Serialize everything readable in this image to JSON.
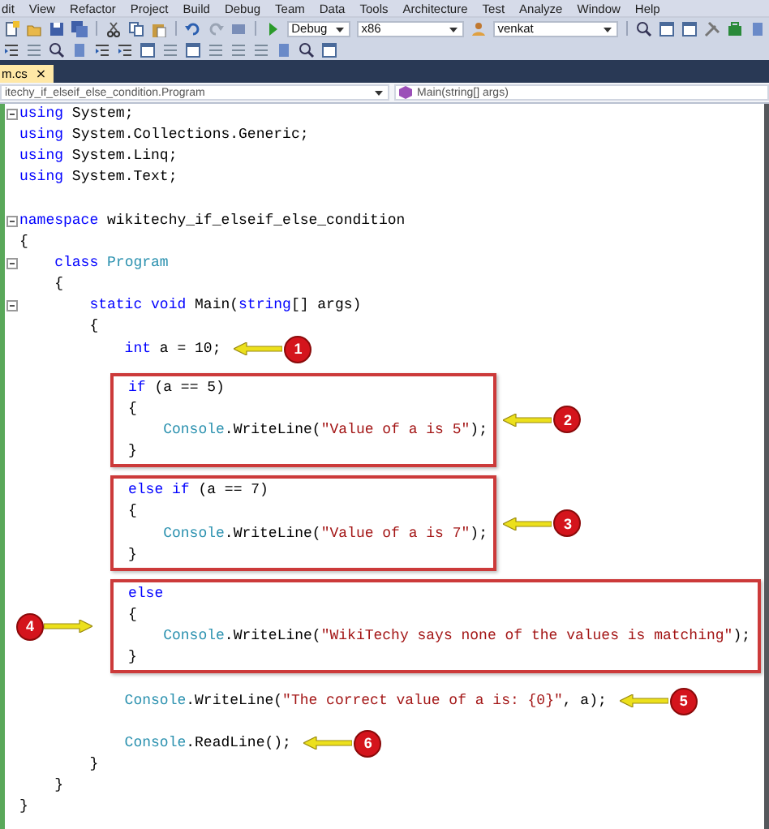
{
  "menu_bar": {
    "items": [
      "dit",
      "View",
      "Refactor",
      "Project",
      "Build",
      "Debug",
      "Team",
      "Data",
      "Tools",
      "Architecture",
      "Test",
      "Analyze",
      "Window",
      "Help"
    ]
  },
  "toolbar": {
    "configuration": "Debug",
    "platform": "x86",
    "user": "venkat"
  },
  "tabs": [
    {
      "label": "m.cs",
      "close_glyph": "×",
      "selected": true
    }
  ],
  "navigation_bar": {
    "type_scope": "itechy_if_elseif_else_condition.Program",
    "member": "Main(string[] args)"
  },
  "code": [
    {
      "kind": "line",
      "gap_before": false,
      "collapsible": true,
      "tokens": [
        {
          "kind": "keyword",
          "text": "using"
        },
        {
          "kind": "plain",
          "text": " System;"
        }
      ]
    },
    {
      "kind": "line",
      "gap_before": false,
      "collapsible": false,
      "tokens": [
        {
          "kind": "keyword",
          "text": "using"
        },
        {
          "kind": "plain",
          "text": " System.Collections.Generic;"
        }
      ]
    },
    {
      "kind": "line",
      "gap_before": false,
      "collapsible": false,
      "tokens": [
        {
          "kind": "keyword",
          "text": "using"
        },
        {
          "kind": "plain",
          "text": " System.Linq;"
        }
      ]
    },
    {
      "kind": "line",
      "gap_before": false,
      "collapsible": false,
      "tokens": [
        {
          "kind": "keyword",
          "text": "using"
        },
        {
          "kind": "plain",
          "text": " System.Text;"
        }
      ]
    },
    {
      "kind": "line",
      "gap_before": true,
      "collapsible": true,
      "tokens": [
        {
          "kind": "keyword",
          "text": "namespace"
        },
        {
          "kind": "plain",
          "text": " wikitechy_if_elseif_else_condition"
        }
      ]
    },
    {
      "kind": "line",
      "gap_before": false,
      "collapsible": false,
      "tokens": [
        {
          "kind": "plain",
          "text": "{"
        }
      ]
    },
    {
      "kind": "line",
      "gap_before": false,
      "collapsible": true,
      "tokens": [
        {
          "kind": "keyword",
          "text": "    class "
        },
        {
          "kind": "type",
          "text": "Program"
        }
      ]
    },
    {
      "kind": "line",
      "gap_before": false,
      "collapsible": false,
      "tokens": [
        {
          "kind": "plain",
          "text": "    {"
        }
      ]
    },
    {
      "kind": "line",
      "gap_before": false,
      "collapsible": true,
      "tokens": [
        {
          "kind": "keyword",
          "text": "        static void"
        },
        {
          "kind": "plain",
          "text": " Main("
        },
        {
          "kind": "keyword",
          "text": "string"
        },
        {
          "kind": "plain",
          "text": "[] args)"
        }
      ]
    },
    {
      "kind": "line",
      "gap_before": false,
      "collapsible": false,
      "tokens": [
        {
          "kind": "plain",
          "text": "        {"
        }
      ]
    },
    {
      "kind": "line",
      "gap_before": false,
      "collapsible": false,
      "callout": {
        "number": "1",
        "kind": "right"
      },
      "tokens": [
        {
          "kind": "keyword",
          "text": "            int"
        },
        {
          "kind": "plain",
          "text": " a = 10;"
        }
      ]
    },
    {
      "kind": "boxed",
      "gap_before": true,
      "callout": {
        "number": "2",
        "kind": "right"
      },
      "lines": [
        {
          "tokens": [
            {
              "kind": "keyword",
              "text": "if"
            },
            {
              "kind": "plain",
              "text": " (a == 5)"
            }
          ]
        },
        {
          "tokens": [
            {
              "kind": "plain",
              "text": "{"
            }
          ]
        },
        {
          "tokens": [
            {
              "kind": "type",
              "text": "    Console"
            },
            {
              "kind": "plain",
              "text": ".WriteLine("
            },
            {
              "kind": "string",
              "text": "\"Value of a is 5\""
            },
            {
              "kind": "plain",
              "text": ");"
            }
          ]
        },
        {
          "tokens": [
            {
              "kind": "plain",
              "text": "}"
            }
          ]
        }
      ]
    },
    {
      "kind": "boxed",
      "gap_before": true,
      "callout": {
        "number": "3",
        "kind": "right"
      },
      "lines": [
        {
          "tokens": [
            {
              "kind": "keyword",
              "text": "else if"
            },
            {
              "kind": "plain",
              "text": " (a == 7)"
            }
          ]
        },
        {
          "tokens": [
            {
              "kind": "plain",
              "text": "{"
            }
          ]
        },
        {
          "tokens": [
            {
              "kind": "type",
              "text": "    Console"
            },
            {
              "kind": "plain",
              "text": ".WriteLine("
            },
            {
              "kind": "string",
              "text": "\"Value of a is 7\""
            },
            {
              "kind": "plain",
              "text": ");"
            }
          ]
        },
        {
          "tokens": [
            {
              "kind": "plain",
              "text": "}"
            }
          ]
        }
      ]
    },
    {
      "kind": "boxed",
      "gap_before": true,
      "callout": {
        "number": "4",
        "kind": "left"
      },
      "lines": [
        {
          "tokens": [
            {
              "kind": "keyword",
              "text": "else"
            }
          ]
        },
        {
          "tokens": [
            {
              "kind": "plain",
              "text": "{"
            }
          ]
        },
        {
          "tokens": [
            {
              "kind": "type",
              "text": "    Console"
            },
            {
              "kind": "plain",
              "text": ".WriteLine("
            },
            {
              "kind": "string",
              "text": "\"WikiTechy says none of the values is matching\""
            },
            {
              "kind": "plain",
              "text": ");"
            }
          ]
        },
        {
          "tokens": [
            {
              "kind": "plain",
              "text": "}"
            }
          ]
        }
      ]
    },
    {
      "kind": "line",
      "gap_before": true,
      "collapsible": false,
      "callout": {
        "number": "5",
        "kind": "right"
      },
      "tokens": [
        {
          "kind": "type",
          "text": "            Console"
        },
        {
          "kind": "plain",
          "text": ".WriteLine("
        },
        {
          "kind": "string",
          "text": "\"The correct value of a is: {0}\""
        },
        {
          "kind": "plain",
          "text": ", a);"
        }
      ]
    },
    {
      "kind": "line",
      "gap_before": true,
      "collapsible": false,
      "callout": {
        "number": "6",
        "kind": "right"
      },
      "tokens": [
        {
          "kind": "type",
          "text": "            Console"
        },
        {
          "kind": "plain",
          "text": ".ReadLine();"
        }
      ]
    },
    {
      "kind": "line",
      "gap_before": false,
      "collapsible": false,
      "tokens": [
        {
          "kind": "plain",
          "text": "        }"
        }
      ]
    },
    {
      "kind": "line",
      "gap_before": false,
      "collapsible": false,
      "tokens": [
        {
          "kind": "plain",
          "text": "    }"
        }
      ]
    },
    {
      "kind": "line",
      "gap_before": false,
      "collapsible": false,
      "tokens": [
        {
          "kind": "plain",
          "text": "}"
        }
      ]
    }
  ]
}
